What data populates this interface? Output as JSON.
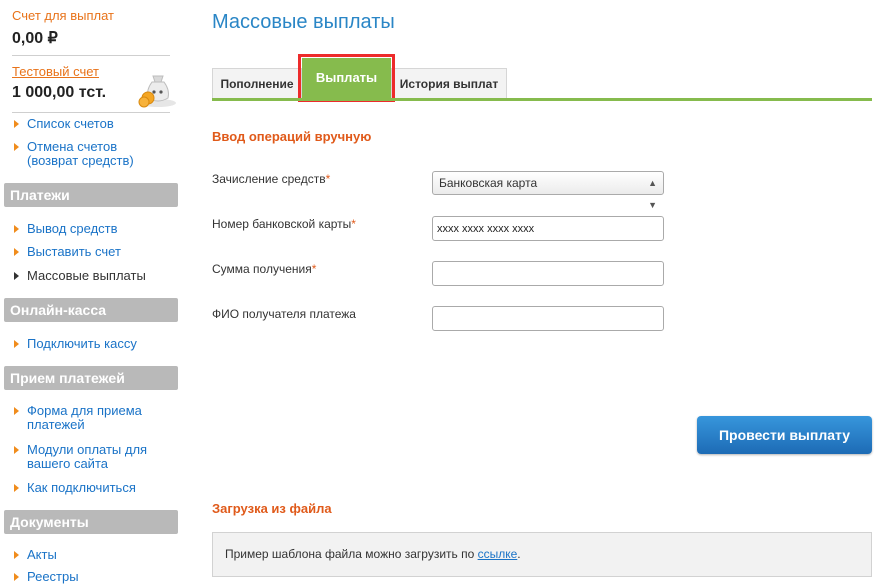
{
  "sidebar": {
    "payout_account": {
      "label": "Счет для выплат",
      "amount": "0,00 ₽"
    },
    "test_account": {
      "label": "Тестовый счет",
      "amount": "1 000,00 тст."
    },
    "top_links": [
      {
        "label": "Список счетов"
      },
      {
        "label": "Отмена счетов (возврат средств)"
      }
    ],
    "sections": [
      {
        "title": "Платежи",
        "items": [
          "Вывод средств",
          "Выставить счет",
          "Массовые выплаты"
        ]
      },
      {
        "title": "Онлайн-касса",
        "items": [
          "Подключить кассу"
        ]
      },
      {
        "title": "Прием платежей",
        "items": [
          "Форма для приема платежей",
          "Модули оплаты для вашего сайта",
          "Как подключиться"
        ]
      },
      {
        "title": "Документы",
        "items": [
          "Акты",
          "Реестры"
        ]
      }
    ]
  },
  "main": {
    "title": "Массовые выплаты",
    "tabs": [
      "Пополнение",
      "Выплаты",
      "История выплат"
    ],
    "manual_section_title": "Ввод операций вручную",
    "form": {
      "credit_label": "Зачисление средств",
      "credit_value": "Банковская карта",
      "card_label": "Номер банковской карты",
      "card_value": "xxxx xxxx xxxx xxxx",
      "amount_label": "Сумма получения",
      "amount_value": "",
      "name_label": "ФИО получателя платежа",
      "name_value": "",
      "required_mark": "*"
    },
    "submit_label": "Провести выплату",
    "file_section_title": "Загрузка из файла",
    "file_hint": "Пример шаблона файла можно загрузить по ",
    "file_link": "ссылке",
    "file_hint_end": "."
  },
  "colors": {
    "accent_orange": "#e05a1a",
    "link_blue": "#1a73c7",
    "tab_green": "#86bb4d",
    "highlight_red": "#ed2b2b",
    "button_blue": "#2a7fc8"
  }
}
